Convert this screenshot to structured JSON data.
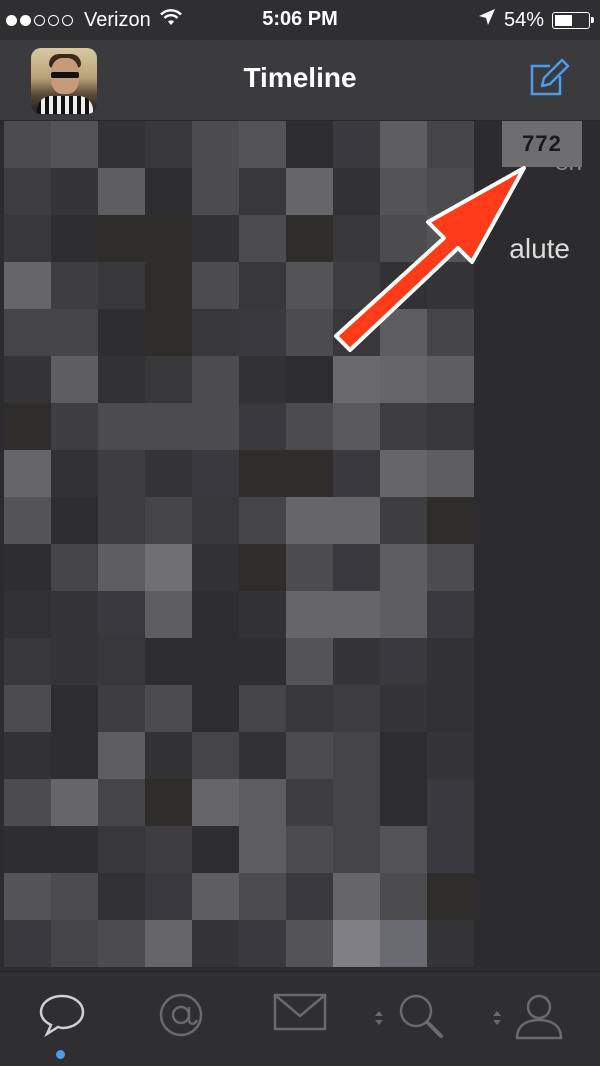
{
  "status_bar": {
    "carrier": "Verizon",
    "time": "5:06 PM",
    "battery": "54%",
    "battery_level": 0.54,
    "signal_bars": 2,
    "signal_total": 5
  },
  "nav": {
    "title": "Timeline"
  },
  "timeline": {
    "unread_count": "772",
    "partial_time": "8h",
    "partial_text": "alute"
  },
  "tabs": [
    {
      "name": "timeline",
      "icon": "speech-bubble-icon",
      "active": true
    },
    {
      "name": "mentions",
      "icon": "at-icon",
      "active": false
    },
    {
      "name": "messages",
      "icon": "envelope-icon",
      "active": false
    },
    {
      "name": "search",
      "icon": "search-icon",
      "active": false
    },
    {
      "name": "profile",
      "icon": "person-icon",
      "active": false
    }
  ],
  "colors": {
    "accent": "#4a9cf0",
    "arrow": "#ff3b1a",
    "background": "#2c2c2e"
  }
}
